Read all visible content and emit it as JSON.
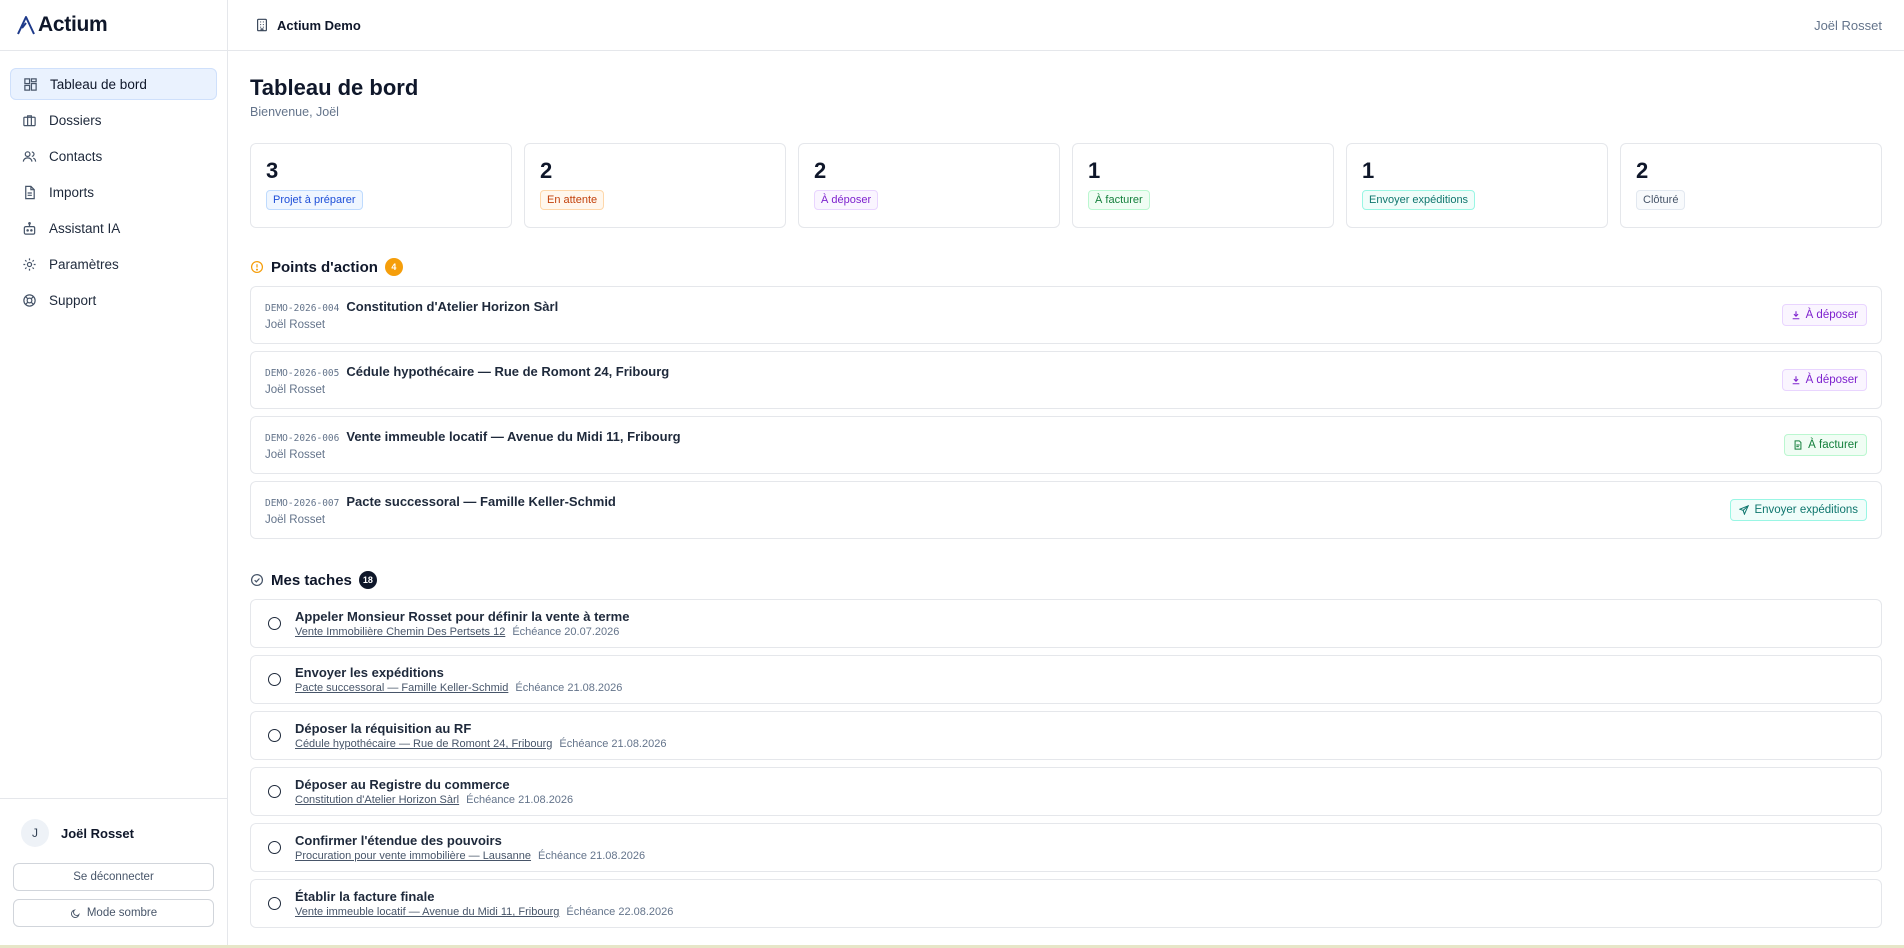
{
  "brand": {
    "name": "Actium"
  },
  "sidebar": {
    "items": [
      {
        "label": "Tableau de bord",
        "icon": "dashboard-icon",
        "active": true
      },
      {
        "label": "Dossiers",
        "icon": "briefcase-icon"
      },
      {
        "label": "Contacts",
        "icon": "users-icon"
      },
      {
        "label": "Imports",
        "icon": "file-icon"
      },
      {
        "label": "Assistant IA",
        "icon": "bot-icon"
      },
      {
        "label": "Paramètres",
        "icon": "gear-icon"
      },
      {
        "label": "Support",
        "icon": "lifebuoy-icon"
      }
    ],
    "user": {
      "initial": "J",
      "name": "Joël Rosset"
    },
    "logout_label": "Se déconnecter",
    "darkmode_label": "Mode sombre"
  },
  "topbar": {
    "org": "Actium Demo",
    "user": "Joël Rosset"
  },
  "page": {
    "title": "Tableau de bord",
    "subtitle": "Bienvenue, Joël"
  },
  "stats": [
    {
      "value": "3",
      "label": "Projet à préparer",
      "color": "#1d4ed8",
      "bg": "#eff6ff",
      "border": "#bfdbfe"
    },
    {
      "value": "2",
      "label": "En attente",
      "color": "#c2410c",
      "bg": "#fff7ed",
      "border": "#fed7aa"
    },
    {
      "value": "2",
      "label": "À déposer",
      "color": "#7e22ce",
      "bg": "#faf5ff",
      "border": "#e9d5ff"
    },
    {
      "value": "1",
      "label": "À facturer",
      "color": "#15803d",
      "bg": "#f0fdf4",
      "border": "#bbf7d0"
    },
    {
      "value": "1",
      "label": "Envoyer expéditions",
      "color": "#0f766e",
      "bg": "#f0fdfa",
      "border": "#99f6e4"
    },
    {
      "value": "2",
      "label": "Clôturé",
      "color": "#475569",
      "bg": "#f8fafc",
      "border": "#e2e8f0"
    }
  ],
  "actions_section": {
    "title": "Points d'action",
    "count": "4",
    "count_color": "#f59e0b"
  },
  "actions": [
    {
      "ref": "DEMO-2026-004",
      "title": "Constitution d'Atelier Horizon Sàrl",
      "owner": "Joël Rosset",
      "button": "À déposer",
      "icon": "download-icon",
      "color": "#7e22ce",
      "bg": "#faf5ff",
      "border": "#e9d5ff"
    },
    {
      "ref": "DEMO-2026-005",
      "title": "Cédule hypothécaire — Rue de Romont 24, Fribourg",
      "owner": "Joël Rosset",
      "button": "À déposer",
      "icon": "download-icon",
      "color": "#7e22ce",
      "bg": "#faf5ff",
      "border": "#e9d5ff"
    },
    {
      "ref": "DEMO-2026-006",
      "title": "Vente immeuble locatif — Avenue du Midi 11, Fribourg",
      "owner": "Joël Rosset",
      "button": "À facturer",
      "icon": "invoice-icon",
      "color": "#15803d",
      "bg": "#f0fdf4",
      "border": "#bbf7d0"
    },
    {
      "ref": "DEMO-2026-007",
      "title": "Pacte successoral — Famille Keller-Schmid",
      "owner": "Joël Rosset",
      "button": "Envoyer expéditions",
      "icon": "send-icon",
      "color": "#0f766e",
      "bg": "#f0fdfa",
      "border": "#99f6e4"
    }
  ],
  "tasks_section": {
    "title": "Mes taches",
    "count": "18",
    "count_color": "#0f172a"
  },
  "tasks": [
    {
      "title": "Appeler Monsieur Rosset pour définir la vente à terme",
      "link": "Vente Immobilière Chemin Des Pertsets 12",
      "due": "Échéance 20.07.2026"
    },
    {
      "title": "Envoyer les expéditions",
      "link": "Pacte successoral — Famille Keller-Schmid",
      "due": "Échéance 21.08.2026"
    },
    {
      "title": "Déposer la réquisition au RF",
      "link": "Cédule hypothécaire — Rue de Romont 24, Fribourg",
      "due": "Échéance 21.08.2026"
    },
    {
      "title": "Déposer au Registre du commerce",
      "link": "Constitution d'Atelier Horizon Sàrl",
      "due": "Échéance 21.08.2026"
    },
    {
      "title": "Confirmer l'étendue des pouvoirs",
      "link": "Procuration pour vente immobilière — Lausanne",
      "due": "Échéance 21.08.2026"
    },
    {
      "title": "Établir la facture finale",
      "link": "Vente immeuble locatif — Avenue du Midi 11, Fribourg",
      "due": "Échéance 22.08.2026"
    }
  ]
}
